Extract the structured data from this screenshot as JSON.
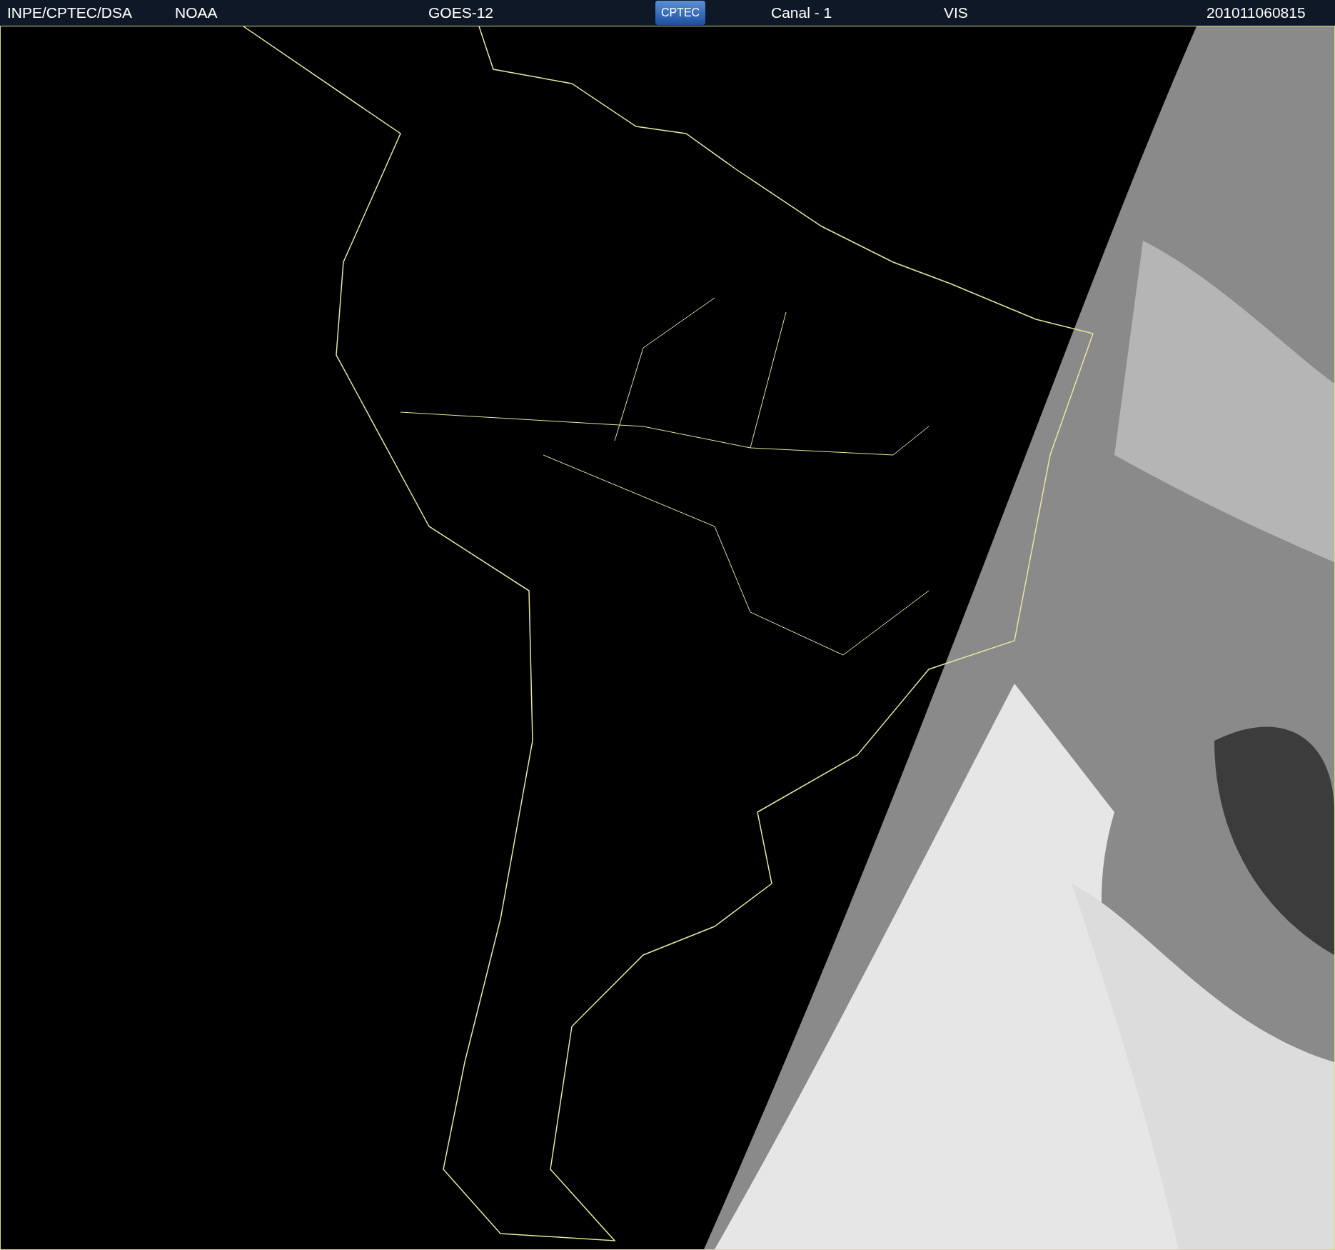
{
  "header": {
    "items": [
      {
        "kind": "text",
        "text": "INPE/CPTEC/DSA"
      },
      {
        "kind": "text",
        "text": "NOAA"
      },
      {
        "kind": "text",
        "text": "GOES-12"
      },
      {
        "kind": "logo",
        "text": "CPTEC"
      },
      {
        "kind": "text",
        "text": "Canal - 1"
      },
      {
        "kind": "text",
        "text": "VIS"
      },
      {
        "kind": "text",
        "text": "201011060815"
      }
    ]
  }
}
